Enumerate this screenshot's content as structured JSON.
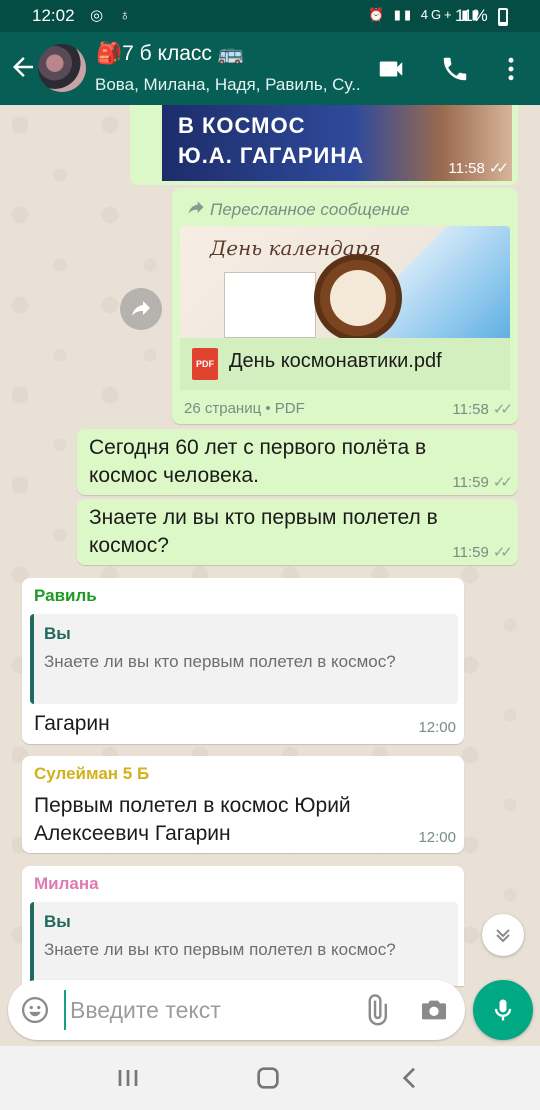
{
  "status_bar": {
    "time": "12:02",
    "left_icons": "◎ ♁",
    "right_icons": "⏰ ▮▮ 4G+ ▮▮",
    "battery": "11%"
  },
  "header": {
    "title": "🎒7 б класс 🚌",
    "subtitle": "Вова, Милана, Надя, Равиль, Су..."
  },
  "messages": {
    "image_banner": {
      "line1": "В КОСМОС",
      "line2": "Ю.А. ГАГАРИНА",
      "time": "11:58"
    },
    "forwarded": {
      "label": "Пересланное сообщение",
      "preview_title": "День календаря",
      "file_icon": "PDF",
      "file_name": "День космонавтики.pdf",
      "file_meta": "26 страниц • PDF",
      "time": "11:58"
    },
    "out1": {
      "text": "Сегодня 60 лет с первого полёта в космос человека.",
      "time": "11:59"
    },
    "out2": {
      "text": "Знаете ли вы кто первым полетел в космос?",
      "time": "11:59"
    },
    "in1": {
      "sender": "Равиль",
      "sender_color": "#1f9a24",
      "quote_author": "Вы",
      "quote_text": "Знаете ли вы кто первым полетел в космос?",
      "text": "Гагарин",
      "time": "12:00"
    },
    "in2": {
      "sender": "Сулейман 5 Б",
      "sender_color": "#d2b21b",
      "text": "Первым полетел в космос Юрий Алексеевич Гагарин",
      "time": "12:00"
    },
    "in3": {
      "sender": "Милана",
      "sender_color": "#e07ab2",
      "quote_author": "Вы",
      "quote_text": "Знаете ли вы кто первым полетел в космос?"
    }
  },
  "composer": {
    "placeholder": "Введите текст"
  },
  "colors": {
    "header": "#075e54",
    "accent": "#00a884",
    "out_bubble": "#dcf8c6"
  }
}
